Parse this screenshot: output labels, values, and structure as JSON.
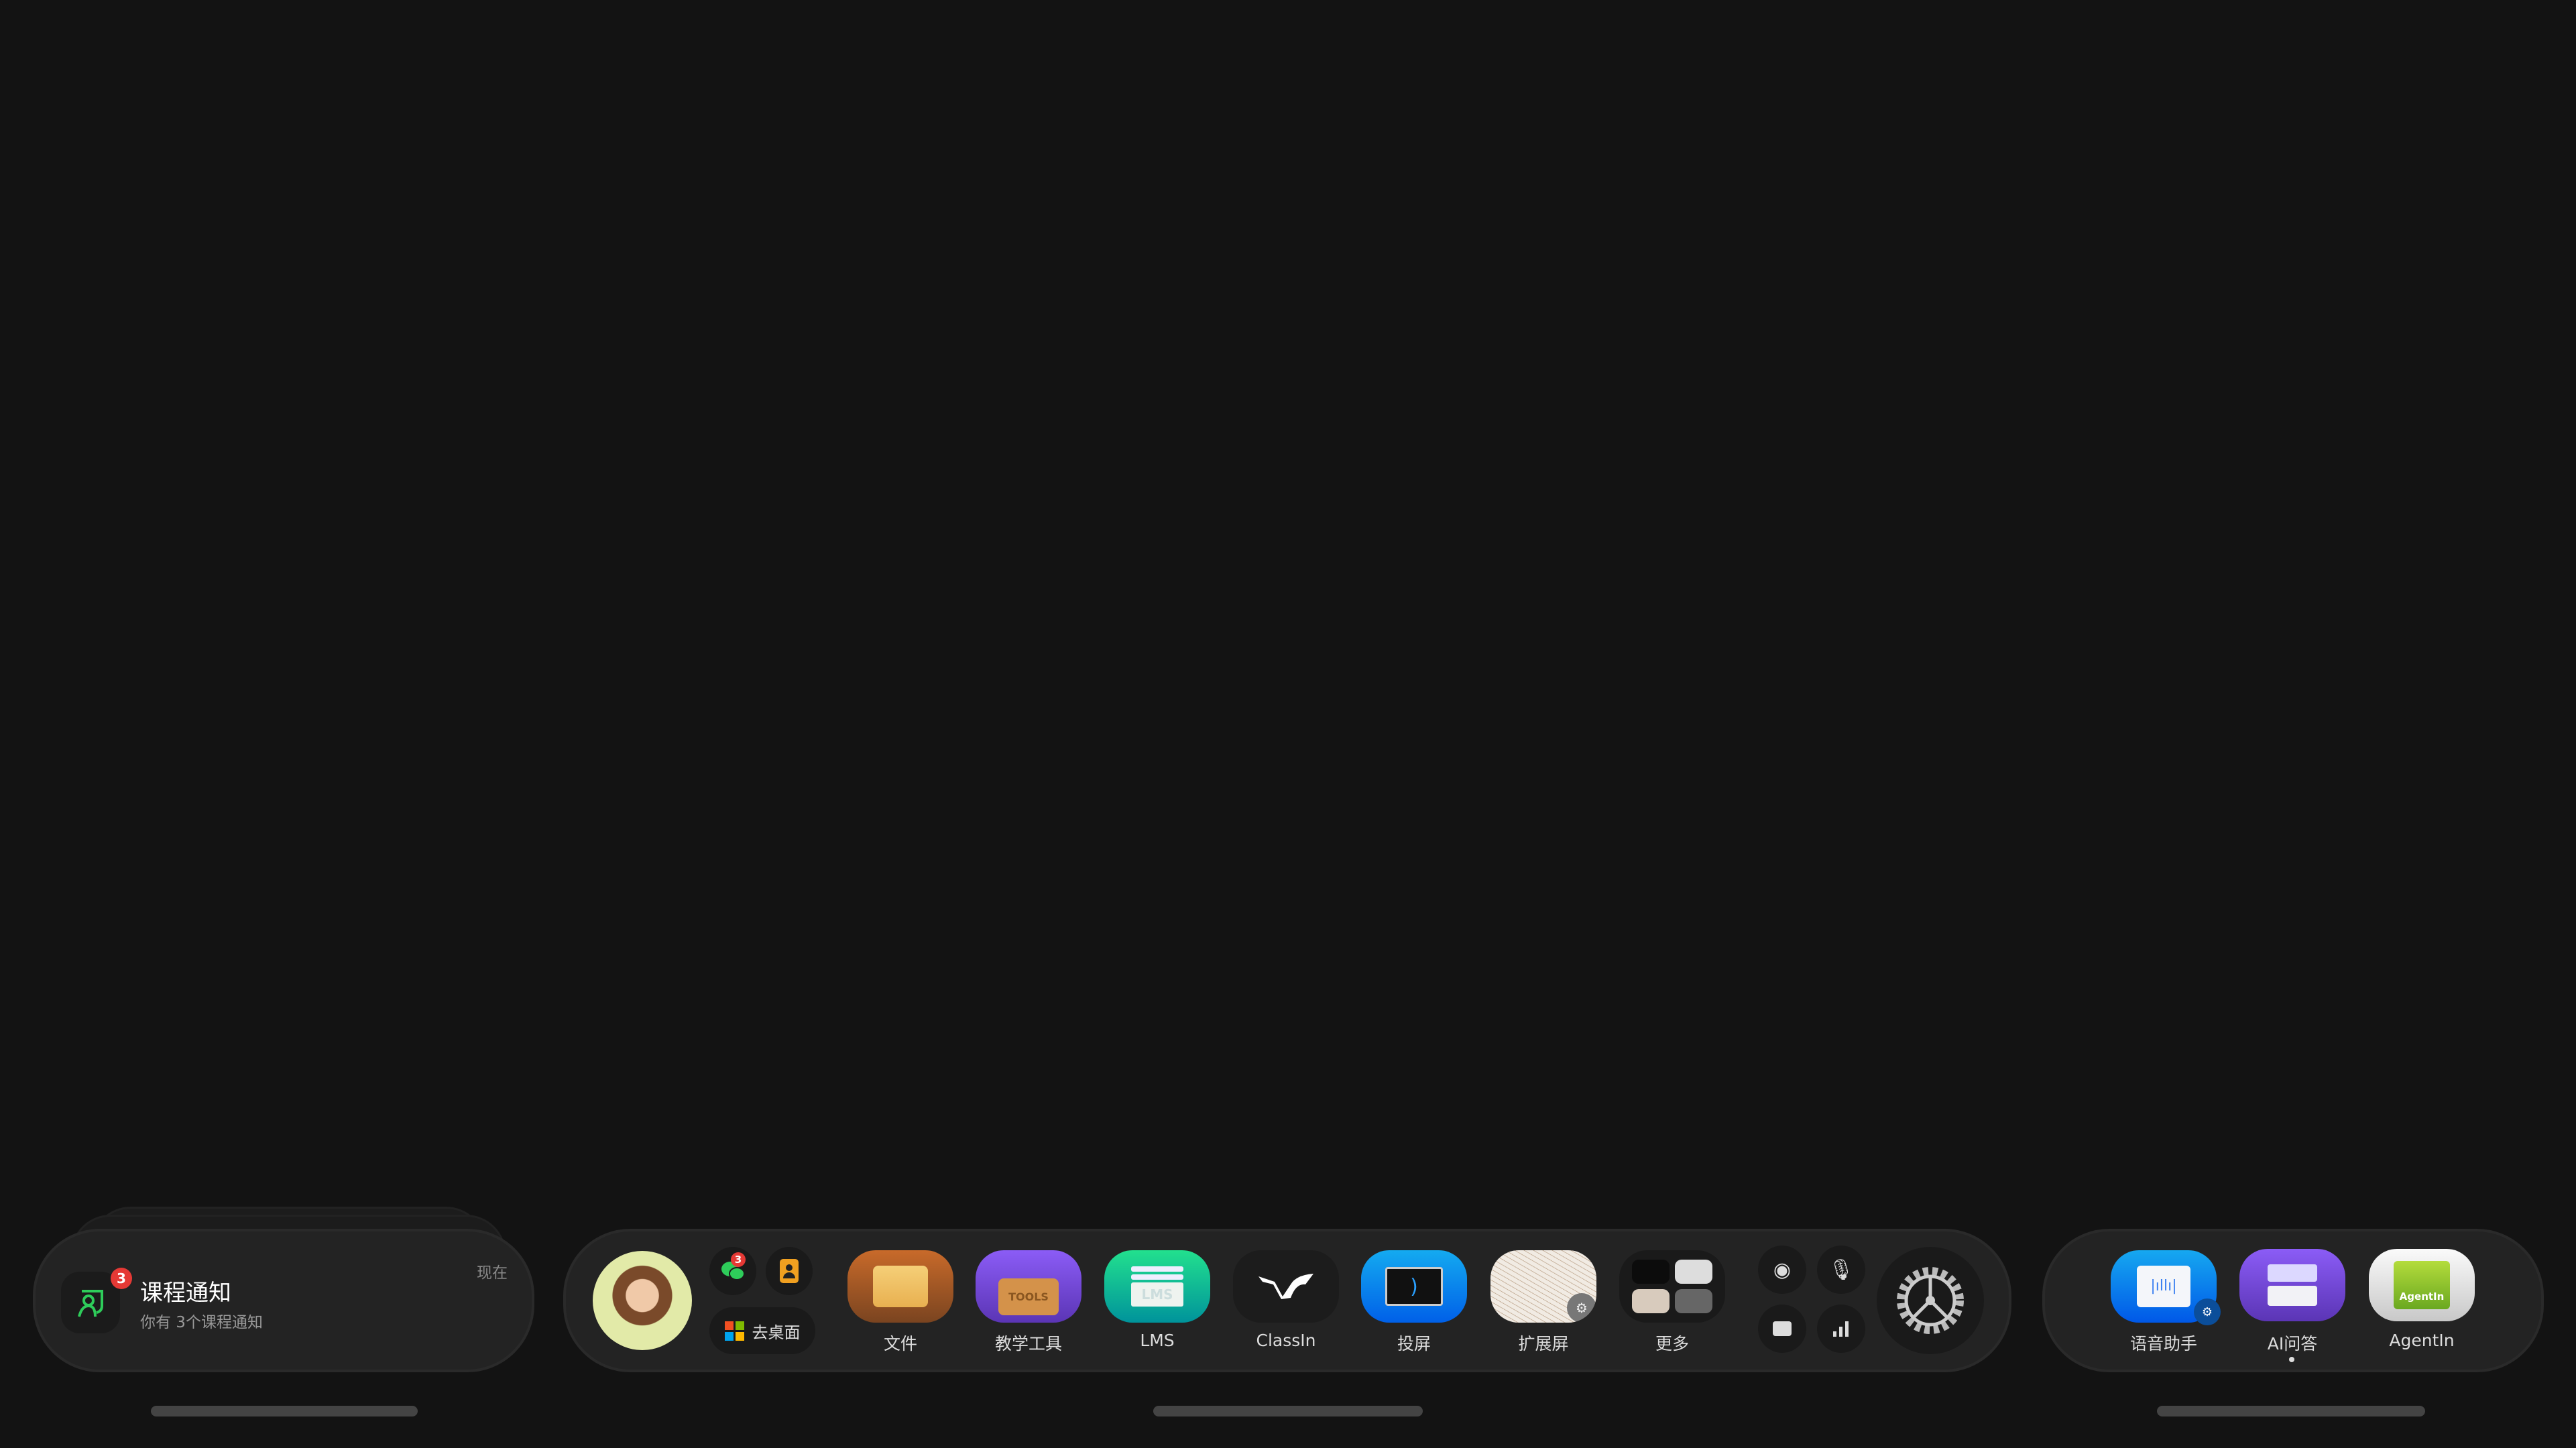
{
  "notification": {
    "title": "课程通知",
    "subtitle": "你有 3个课程通知",
    "time": "现在",
    "badge": "3",
    "accent": "#2ecc5a"
  },
  "dock": {
    "wechat_badge": "3",
    "desktop_label": "去桌面",
    "apps": [
      {
        "label": "文件",
        "icon": "folder-icon"
      },
      {
        "label": "教学工具",
        "icon": "tools-icon",
        "icon_text": "TOOLS"
      },
      {
        "label": "LMS",
        "icon": "lms-icon",
        "icon_text": "LMS"
      },
      {
        "label": "ClassIn",
        "icon": "classin-logo-icon"
      },
      {
        "label": "投屏",
        "icon": "screen-cast-icon"
      },
      {
        "label": "扩展屏",
        "icon": "extended-screen-icon"
      },
      {
        "label": "更多",
        "icon": "more-apps-icon"
      }
    ],
    "controls": [
      "camera-icon",
      "microphone-icon",
      "video-icon",
      "signal-icon",
      "settings-gear-icon"
    ]
  },
  "right_dock": {
    "apps": [
      {
        "label": "语音助手",
        "icon": "voice-assistant-icon"
      },
      {
        "label": "AI问答",
        "icon": "ai-qa-icon",
        "active": true
      },
      {
        "label": "AgentIn",
        "icon": "agentin-icon",
        "icon_text": "AgentIn"
      }
    ]
  },
  "colors": {
    "background": "#131313",
    "panel": "#232323",
    "badge": "#e53935"
  }
}
